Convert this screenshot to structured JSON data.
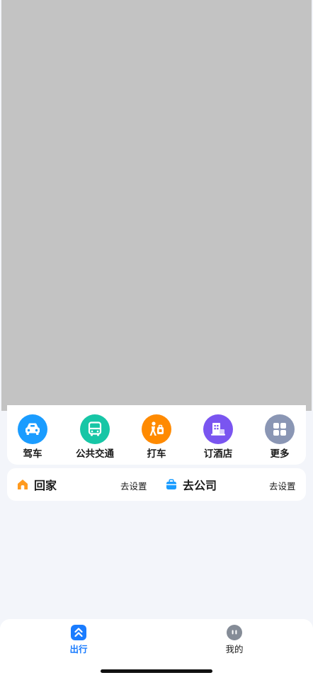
{
  "quick_actions": [
    {
      "label": "驾车",
      "icon": "car-icon",
      "color": "#1a9cff"
    },
    {
      "label": "公共交通",
      "icon": "bus-icon",
      "color": "#17c6a6"
    },
    {
      "label": "打车",
      "icon": "taxi-icon",
      "color": "#ff8a00"
    },
    {
      "label": "订酒店",
      "icon": "hotel-icon",
      "color": "#7a55f0"
    },
    {
      "label": "更多",
      "icon": "grid-icon",
      "color": "#8a96b4"
    }
  ],
  "shortcuts": {
    "home": {
      "title": "回家",
      "action": "去设置",
      "icon": "home-icon",
      "color": "#ff9a1f"
    },
    "work": {
      "title": "去公司",
      "action": "去设置",
      "icon": "briefcase-icon",
      "color": "#1a9cff"
    }
  },
  "tabbar": {
    "tabs": [
      {
        "label": "出行",
        "icon": "route-icon",
        "active": true
      },
      {
        "label": "我的",
        "icon": "profile-icon",
        "active": false
      }
    ],
    "active_color": "#1a7cff"
  }
}
